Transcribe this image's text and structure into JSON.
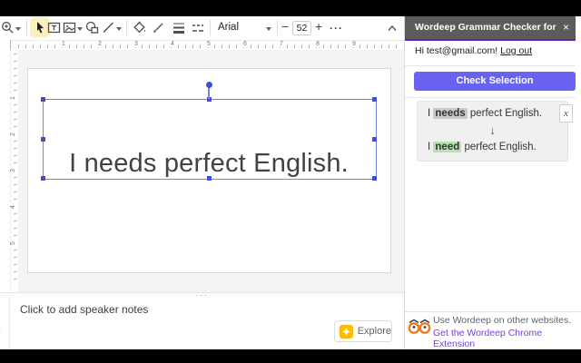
{
  "toolbar": {
    "font_name": "Arial",
    "font_size": "52",
    "decrease_label": "−",
    "increase_label": "+",
    "more_label": "···"
  },
  "rulers": {
    "h": [
      "1",
      "2",
      "3",
      "4",
      "5",
      "6",
      "7",
      "8",
      "9"
    ],
    "v": [
      "1",
      "2",
      "3",
      "4",
      "5"
    ]
  },
  "slide": {
    "text": "I needs perfect English."
  },
  "notes": {
    "placeholder": "Click to add speaker notes",
    "collapse_glyph": "‹",
    "resize_dots": "···"
  },
  "explore": {
    "label": "Explore"
  },
  "panel": {
    "title": "Wordeep Grammar Checker for Slides",
    "close_glyph": "×",
    "greeting": "Hi test@gmail.com!",
    "logout_label": "Log out",
    "check_button": "Check Selection",
    "suggestion": {
      "original": {
        "prefix": "I",
        "word": "needs",
        "suffix": "perfect English."
      },
      "arrow": "↓",
      "corrected": {
        "prefix": "I",
        "word": "need",
        "suffix": "perfect English."
      },
      "dismiss_glyph": "x"
    },
    "footer": {
      "line1": "Use Wordeep on other websites.",
      "link": "Get the Wordeep Chrome Extension"
    }
  },
  "colors": {
    "panel_accent": "#5e23bf",
    "check_button": "#6a63f1",
    "highlight_original": "#c9cacb",
    "highlight_corrected": "#b5e2b1",
    "selection": "#4150d0",
    "explore_icon": "#fbbc04",
    "owl_orange": "#ef7b1a",
    "active_tool_bg": "#feefc3"
  }
}
